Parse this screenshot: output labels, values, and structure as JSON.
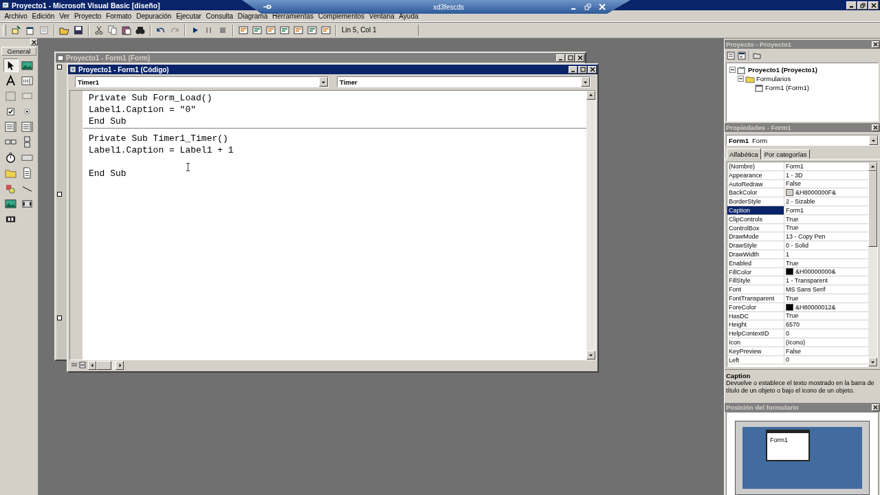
{
  "window": {
    "title": "Proyecto1 - Microsoft Visual Basic [diseño]"
  },
  "connection_bar": {
    "title": "xd3fescds"
  },
  "menu": [
    "Archivo",
    "Edición",
    "Ver",
    "Proyecto",
    "Formato",
    "Depuración",
    "Ejecutar",
    "Consulta",
    "Diagrama",
    "Herramientas",
    "Complementos",
    "Ventana",
    "Ayuda"
  ],
  "toolbar": {
    "position": "Lin 5, Col 1"
  },
  "toolbox": {
    "title": "General",
    "tools": [
      {
        "kind": "pointer",
        "selected": true
      },
      {
        "kind": "picturebox",
        "selected": false
      },
      {
        "kind": "label",
        "selected": false
      },
      {
        "kind": "textbox",
        "selected": false
      },
      {
        "kind": "frame",
        "selected": false
      },
      {
        "kind": "button",
        "selected": false
      },
      {
        "kind": "checkbox",
        "selected": false
      },
      {
        "kind": "radio",
        "selected": false
      },
      {
        "kind": "combobox",
        "selected": false
      },
      {
        "kind": "listbox",
        "selected": false
      },
      {
        "kind": "hscroll",
        "selected": false
      },
      {
        "kind": "vscroll",
        "selected": false
      },
      {
        "kind": "timer",
        "selected": false
      },
      {
        "kind": "drive",
        "selected": false
      },
      {
        "kind": "folder",
        "selected": false
      },
      {
        "kind": "file",
        "selected": false
      },
      {
        "kind": "shape",
        "selected": false
      },
      {
        "kind": "line",
        "selected": false
      },
      {
        "kind": "image",
        "selected": false
      },
      {
        "kind": "data",
        "selected": false
      },
      {
        "kind": "ole",
        "selected": false
      }
    ]
  },
  "form_window": {
    "title": "Proyecto1 - Form1 (Form)"
  },
  "code_window": {
    "title": "Proyecto1 - Form1 (Código)",
    "object": "Timer1",
    "procedure": "Timer",
    "procedures": [
      {
        "lines": [
          {
            "text": "Private Sub Form_Load()",
            "blank_before": false
          },
          {
            "text": "Label1.Caption = \"0\"",
            "blank_before": false
          },
          {
            "text": "End Sub",
            "blank_before": false
          }
        ]
      },
      {
        "lines": [
          {
            "text": "Private Sub Timer1_Timer()",
            "blank_before": false
          },
          {
            "text": "Label1.Caption = Label1 + 1",
            "blank_before": false
          },
          {
            "text": "End Sub",
            "blank_before": true
          }
        ]
      }
    ]
  },
  "project_panel": {
    "title": "Proyecto - Proyecto1",
    "tree": [
      {
        "label": "Proyecto1 (Proyecto1)",
        "kind": "project",
        "expanded": true,
        "children": [
          {
            "label": "Formularios",
            "kind": "folder",
            "expanded": true,
            "children": [
              {
                "label": "Form1 (Form1)",
                "kind": "form"
              }
            ]
          }
        ]
      }
    ]
  },
  "properties_panel": {
    "title": "Propiedades - Form1",
    "object_name": "Form1",
    "object_type": "Form",
    "tabs": [
      {
        "label": "Alfabética",
        "selected": true
      },
      {
        "label": "Por categorías",
        "selected": false
      }
    ],
    "rows": [
      {
        "name": "(Nombre)",
        "value": "Form1",
        "selected": false
      },
      {
        "name": "Appearance",
        "value": "1 - 3D",
        "selected": false
      },
      {
        "name": "AutoRedraw",
        "value": "False",
        "selected": false
      },
      {
        "name": "BackColor",
        "value": "&H8000000F&",
        "selected": false,
        "color": "#d4d0c8"
      },
      {
        "name": "BorderStyle",
        "value": "2 - Sizable",
        "selected": false
      },
      {
        "name": "Caption",
        "value": "Form1",
        "selected": true
      },
      {
        "name": "ClipControls",
        "value": "True",
        "selected": false
      },
      {
        "name": "ControlBox",
        "value": "True",
        "selected": false
      },
      {
        "name": "DrawMode",
        "value": "13 - Copy Pen",
        "selected": false
      },
      {
        "name": "DrawStyle",
        "value": "0 - Solid",
        "selected": false
      },
      {
        "name": "DrawWidth",
        "value": "1",
        "selected": false
      },
      {
        "name": "Enabled",
        "value": "True",
        "selected": false
      },
      {
        "name": "FillColor",
        "value": "&H00000000&",
        "selected": false,
        "color": "#000000"
      },
      {
        "name": "FillStyle",
        "value": "1 - Transparent",
        "selected": false
      },
      {
        "name": "Font",
        "value": "MS Sans Serif",
        "selected": false
      },
      {
        "name": "FontTransparent",
        "value": "True",
        "selected": false
      },
      {
        "name": "ForeColor",
        "value": "&H80000012&",
        "selected": false,
        "color": "#000000"
      },
      {
        "name": "HasDC",
        "value": "True",
        "selected": false
      },
      {
        "name": "Height",
        "value": "6570",
        "selected": false
      },
      {
        "name": "HelpContextID",
        "value": "0",
        "selected": false
      },
      {
        "name": "Icon",
        "value": "(Icono)",
        "selected": false
      },
      {
        "name": "KeyPreview",
        "value": "False",
        "selected": false
      },
      {
        "name": "Left",
        "value": "0",
        "selected": false
      }
    ],
    "description_title": "Caption",
    "description": "Devuelve o establece el texto mostrado en la barra de título de un objeto o bajo el icono de un objeto."
  },
  "form_layout_panel": {
    "title": "Posición del formulario",
    "form_label": "Form1"
  }
}
